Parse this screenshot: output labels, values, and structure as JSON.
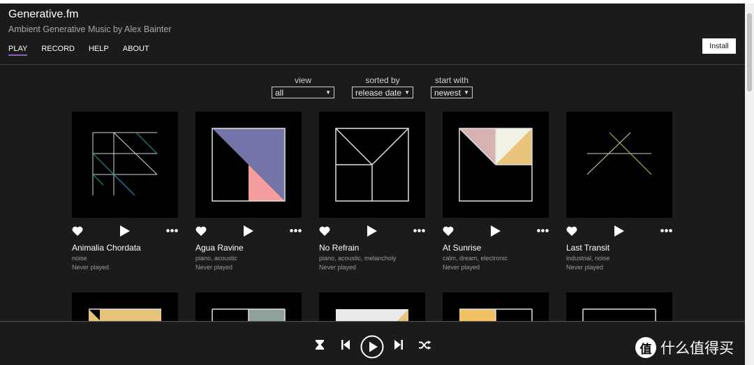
{
  "header": {
    "title": "Generative.fm",
    "subtitle": "Ambient Generative Music by Alex Bainter",
    "nav": [
      "PLAY",
      "RECORD",
      "HELP",
      "ABOUT"
    ],
    "install_label": "Install"
  },
  "filters": {
    "view": {
      "label": "view",
      "value": "all"
    },
    "sorted_by": {
      "label": "sorted by",
      "value": "release date"
    },
    "start_with": {
      "label": "start with",
      "value": "newest"
    }
  },
  "pieces": [
    {
      "title": "Animalia Chordata",
      "tags": "noise",
      "status": "Never played"
    },
    {
      "title": "Agua Ravine",
      "tags": "piano, acoustic",
      "status": "Never played"
    },
    {
      "title": "No Refrain",
      "tags": "piano, acoustic, melancholy",
      "status": "Never played"
    },
    {
      "title": "At Sunrise",
      "tags": "calm, dream, electronic",
      "status": "Never played"
    },
    {
      "title": "Last Transit",
      "tags": "industrial, noise",
      "status": "Never played"
    }
  ],
  "player": {
    "controls": [
      "timer-icon",
      "previous-icon",
      "play-icon",
      "next-icon",
      "shuffle-icon"
    ]
  },
  "watermark": {
    "badge": "值",
    "text": "什么值得买"
  },
  "colors": {
    "accent": "#8a5fbf",
    "background": "#1b1b1b",
    "teal": "#1d8a96",
    "lavender": "#7474a8",
    "salmon": "#f59e9e",
    "gold": "#e8c47a",
    "pink": "#d8b1b1"
  }
}
